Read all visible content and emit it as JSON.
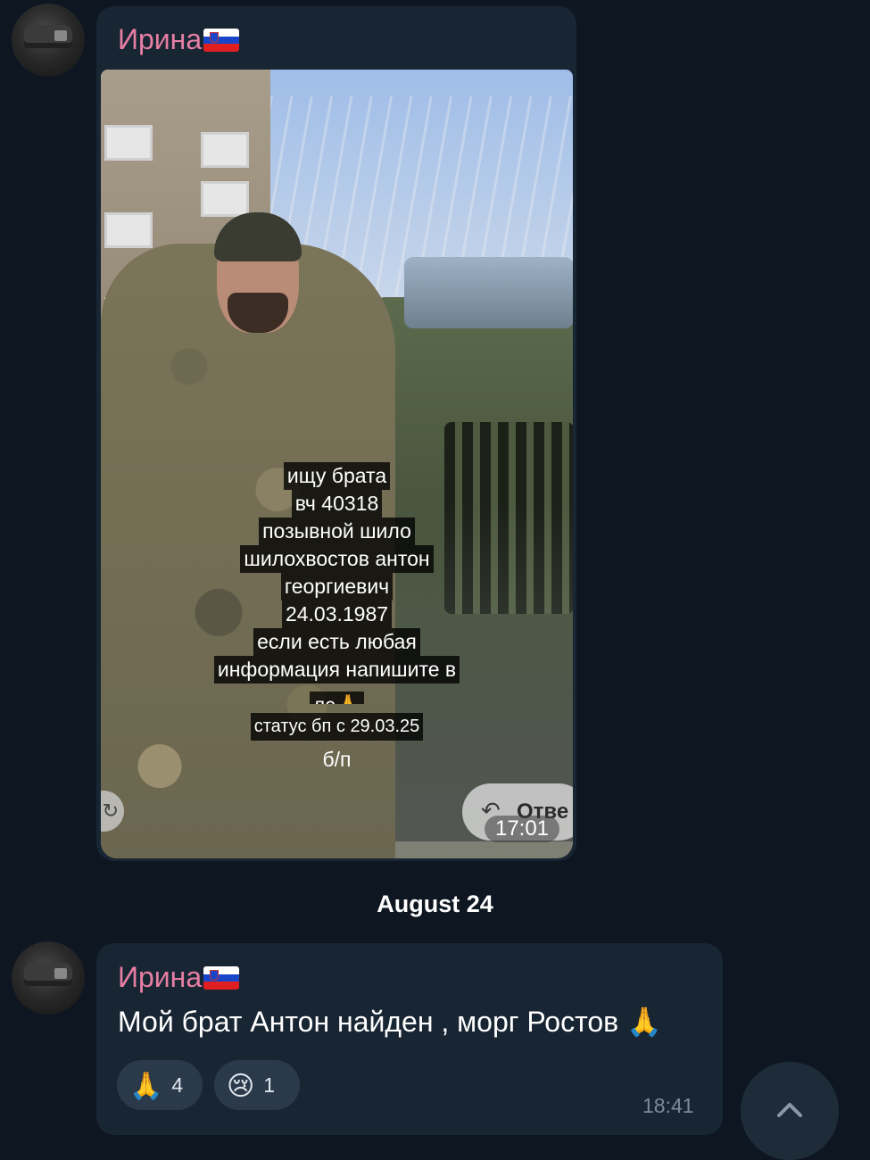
{
  "messages": [
    {
      "sender": "Ирина",
      "sender_flag": "slovenia-flag",
      "photo": {
        "overlay_lines": [
          "ищу брата",
          "вч 40318",
          "позывной шило",
          "шилохвостов антон",
          "георгиевич",
          "24.03.1987",
          "если есть любая",
          "информация напишите в",
          "лс🙏",
          "статус бп с 29.03.25",
          "б/п"
        ],
        "reply_chip_text": "Отве",
        "time": "17:01"
      }
    },
    {
      "sender": "Ирина",
      "sender_flag": "slovenia-flag",
      "text": "Мой брат Антон найден , морг Ростов 🙏",
      "reactions": [
        {
          "emoji": "🙏",
          "count": "4"
        },
        {
          "emoji": "😢",
          "count": "1"
        }
      ],
      "time": "18:41"
    }
  ],
  "date_separator": "August 24",
  "colors": {
    "background": "#0e1621",
    "bubble": "#182533",
    "sender_name": "#e77fa4",
    "reaction_bg": "#2b3a4b",
    "time_text": "#7d8b99"
  },
  "icons": {
    "scroll_down": "chevron-up-icon",
    "reply": "reply-arrow-icon"
  }
}
